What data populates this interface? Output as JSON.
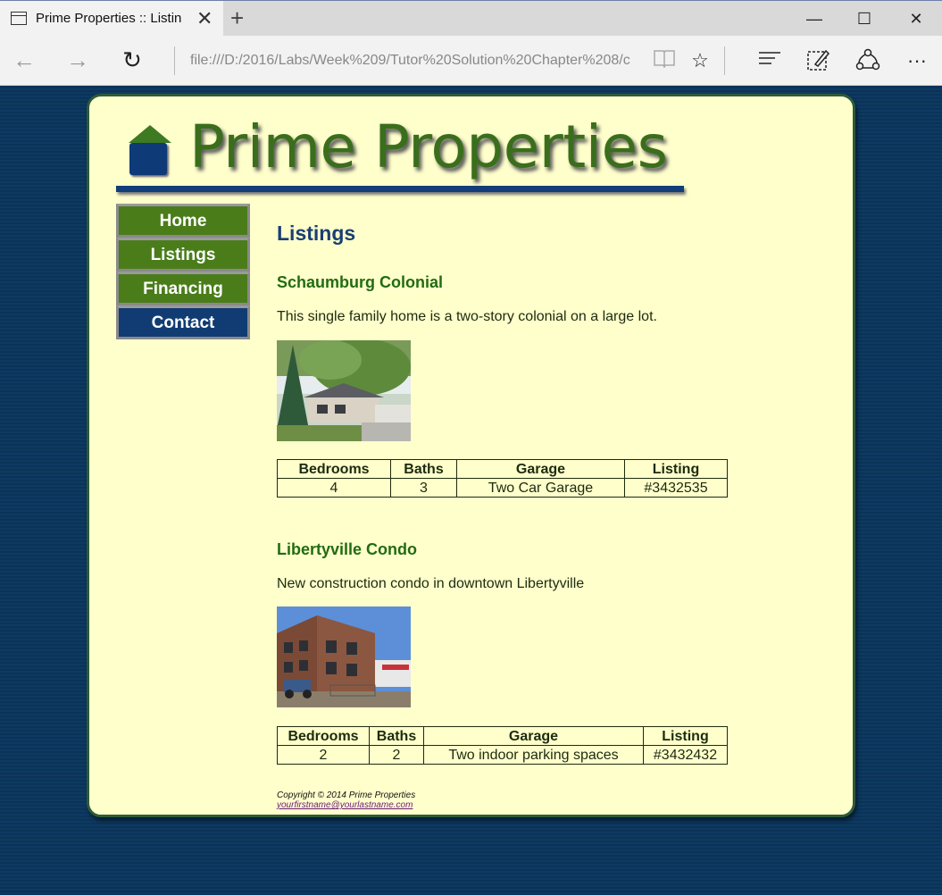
{
  "browser": {
    "tab_title": "Prime Properties :: Listin",
    "url": "file:///D:/2016/Labs/Week%209/Tutor%20Solution%20Chapter%208/c"
  },
  "site": {
    "logo_text": "Prime Properties",
    "nav": [
      "Home",
      "Listings",
      "Financing",
      "Contact"
    ],
    "page_title": "Listings"
  },
  "listings": [
    {
      "title": "Schaumburg Colonial",
      "description": "This single family home is a two-story colonial on a large lot.",
      "specs_headers": [
        "Bedrooms",
        "Baths",
        "Garage",
        "Listing"
      ],
      "specs_values": [
        "4",
        "3",
        "Two Car Garage",
        "#3432535"
      ]
    },
    {
      "title": "Libertyville Condo",
      "description": "New construction condo in downtown Libertyville",
      "specs_headers": [
        "Bedrooms",
        "Baths",
        "Garage",
        "Listing"
      ],
      "specs_values": [
        "2",
        "2",
        "Two indoor parking spaces",
        "#3432432"
      ]
    }
  ],
  "footer": {
    "copyright": "Copyright © 2014 Prime Properties",
    "email": "yourfirstname@yourlastname.com"
  },
  "colors": {
    "page_bg": "#0b3358",
    "container_bg": "#ffffcc",
    "nav_green": "#4a7d1a",
    "nav_contact": "#113c73",
    "heading_blue": "#1a3f73",
    "listing_green": "#236b12"
  },
  "icons": {
    "tab": "tab-icon",
    "close": "close-icon",
    "new_tab": "plus-icon",
    "back": "back-arrow-icon",
    "forward": "forward-arrow-icon",
    "refresh": "refresh-icon",
    "reading_view": "book-icon",
    "favorite": "star-icon",
    "hub": "hub-icon",
    "note": "pen-note-icon",
    "share": "share-icon",
    "more": "more-icon"
  }
}
